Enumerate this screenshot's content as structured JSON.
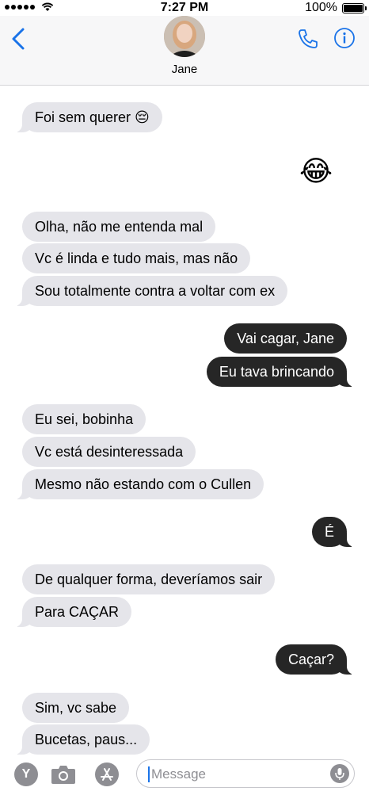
{
  "status_bar": {
    "time": "7:27 PM",
    "battery": "100%"
  },
  "header": {
    "contact_name": "Jane",
    "icons": [
      "back-chevron-icon",
      "phone-icon",
      "info-icon"
    ]
  },
  "messages": [
    {
      "direction": "in",
      "text": "Foi sem querer 😔"
    },
    {
      "direction": "out",
      "text": "😂"
    },
    {
      "direction": "in",
      "text": "Olha, não me entenda mal"
    },
    {
      "direction": "in",
      "text": "Vc é linda e tudo mais, mas não"
    },
    {
      "direction": "in",
      "text": "Sou totalmente contra a voltar com ex"
    },
    {
      "direction": "out",
      "text": "Vai cagar, Jane"
    },
    {
      "direction": "out",
      "text": "Eu tava brincando"
    },
    {
      "direction": "in",
      "text": "Eu sei, bobinha"
    },
    {
      "direction": "in",
      "text": "Vc está desinteressada"
    },
    {
      "direction": "in",
      "text": "Mesmo não estando com o Cullen"
    },
    {
      "direction": "out",
      "text": "É"
    },
    {
      "direction": "in",
      "text": "De qualquer forma, deveríamos sair"
    },
    {
      "direction": "in",
      "text": "Para CAÇAR"
    },
    {
      "direction": "out",
      "text": "Caçar?"
    },
    {
      "direction": "in",
      "text": "Sim, vc sabe"
    },
    {
      "direction": "in",
      "text": "Bucetas, paus..."
    }
  ],
  "input_bar": {
    "app1_letter": "Y",
    "placeholder": "Message"
  },
  "colors": {
    "accent": "#1a73e8",
    "incoming_bubble": "#e5e5ea",
    "outgoing_bubble": "#262626"
  }
}
